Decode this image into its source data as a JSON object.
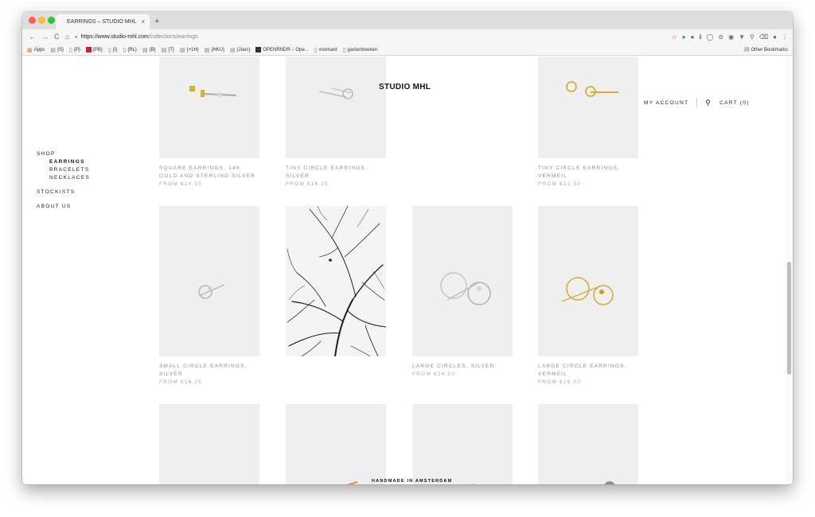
{
  "browser": {
    "tab_title": "EARRINGS – STUDIO MHL",
    "tab_close": "×",
    "new_tab": "+",
    "url_host": "https://www.studio-mhl.com",
    "url_path": "/collections/earrings",
    "nav": {
      "back": "←",
      "forward": "→",
      "reload": "C",
      "home": "⌂"
    },
    "bookmarks": [
      {
        "label": "Apps",
        "icon": "apps-grid-icon"
      },
      {
        "label": "{S}",
        "icon": "folder-icon"
      },
      {
        "label": "{P}",
        "icon": "page-icon"
      },
      {
        "label": "{PB}",
        "icon": "red-square-icon"
      },
      {
        "label": "{I}",
        "icon": "page-icon"
      },
      {
        "label": "{RL}",
        "icon": "page-icon"
      },
      {
        "label": "{B}",
        "icon": "folder-icon"
      },
      {
        "label": "{T}",
        "icon": "folder-icon"
      },
      {
        "label": "{+1H}",
        "icon": "folder-icon"
      },
      {
        "label": "{HKU}",
        "icon": "folder-icon"
      },
      {
        "label": "{Joes}",
        "icon": "folder-icon"
      },
      {
        "label": "OPENRNDR – Ope...",
        "icon": "dark-square-icon"
      },
      {
        "label": "voorkant",
        "icon": "page-icon"
      },
      {
        "label": "gastenboeken",
        "icon": "page-icon"
      }
    ],
    "other_bookmarks": "Other Bookmarks"
  },
  "site": {
    "title": "STUDIO MHL",
    "nav": {
      "shop": "SHOP",
      "earrings": "EARRINGS",
      "bracelets": "BRACELETS",
      "necklaces": "NECKLACES",
      "stockists": "STOCKISTS",
      "about": "ABOUT US"
    },
    "account": "MY ACCOUNT",
    "cart": "CART (0)",
    "footer": "HANDMADE IN AMSTERDAM"
  },
  "products": [
    {
      "name": "SQUARE EARRINGS, 14K GOLD AND STERLING SILVER",
      "price": "FROM  €24.50"
    },
    {
      "name": "TINY CIRCLE EARRINGS, SILVER",
      "price": "FROM  €16.25"
    },
    {
      "name": "TINY CIRCLE EARRINGS, VERMEIL",
      "price": "FROM  €22.50"
    },
    {
      "name": "SMALL CIRCLE EARRINGS, SILVER",
      "price": "FROM  €16.25"
    },
    {
      "name": "LARGE CIRCLES, SILVER",
      "price": "FROM  €24.50"
    },
    {
      "name": "LARGE CIRCLE EARRINGS, VERMEIL",
      "price": "FROM  €29.50"
    }
  ],
  "colors": {
    "product_bg": "#efefef",
    "gold": "#d4ae3a",
    "silver": "#a9a9a9",
    "caption": "#8f8f8f"
  }
}
